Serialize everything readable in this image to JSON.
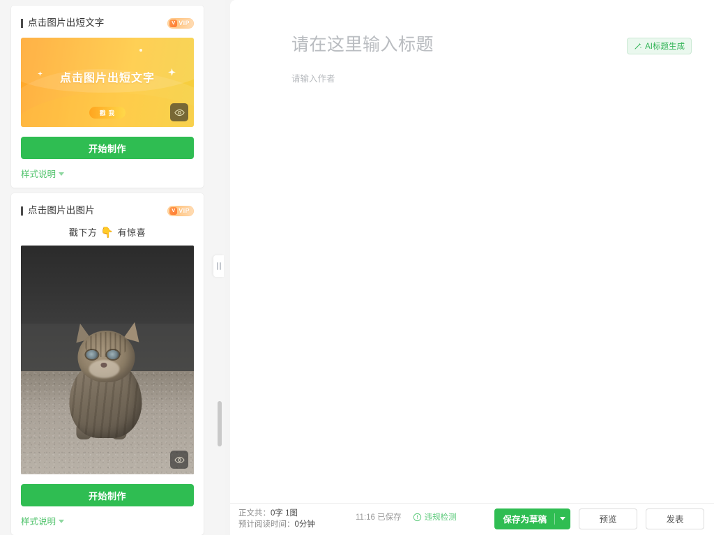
{
  "left_panel": {
    "cards": [
      {
        "title": "点击图片出短文字",
        "badge": {
          "icon": "v-crown-icon",
          "text": "VIP"
        },
        "thumb": {
          "caption": "点击图片出短文字",
          "poke_label": "戳 我",
          "eye_icon": "eye-icon"
        },
        "start_label": "开始制作",
        "style_link": "样式说明"
      },
      {
        "title": "点击图片出图片",
        "badge": {
          "icon": "v-crown-icon",
          "text": "VIP"
        },
        "hint_prefix": "戳下方",
        "hint_icon": "👇",
        "hint_suffix": "有惊喜",
        "photo": {
          "alt": "小猫图片",
          "eye_icon": "eye-icon"
        },
        "start_label": "开始制作",
        "style_link": "样式说明"
      }
    ]
  },
  "splitter": {
    "icon": "drag-handle-icon"
  },
  "editor": {
    "title_placeholder": "请在这里输入标题",
    "title_value": "",
    "author_placeholder": "请输入作者",
    "author_value": "",
    "ai_title_button": {
      "label": "AI标题生成",
      "icon": "magic-wand-icon"
    },
    "content_value": ""
  },
  "bottom_bar": {
    "word_count_label": "正文共：",
    "word_count_value": "0字 1图",
    "read_time_label": "预计阅读时间：",
    "read_time_value": "0分钟",
    "saved_time": "11:16",
    "saved_status": "已保存",
    "risk_check": {
      "label": "违规检测",
      "icon": "shield-check-icon"
    },
    "save_draft": {
      "label": "保存为草稿",
      "dropdown_icon": "caret-down-icon"
    },
    "preview_label": "预览",
    "publish_label": "发表"
  },
  "colors": {
    "brand_green": "#2fbd52",
    "link_green": "#4ec26a",
    "panel_bg": "#f5f5f5",
    "thumb_gradient_start": "#ffa62b",
    "thumb_gradient_end": "#f5cf3e"
  }
}
